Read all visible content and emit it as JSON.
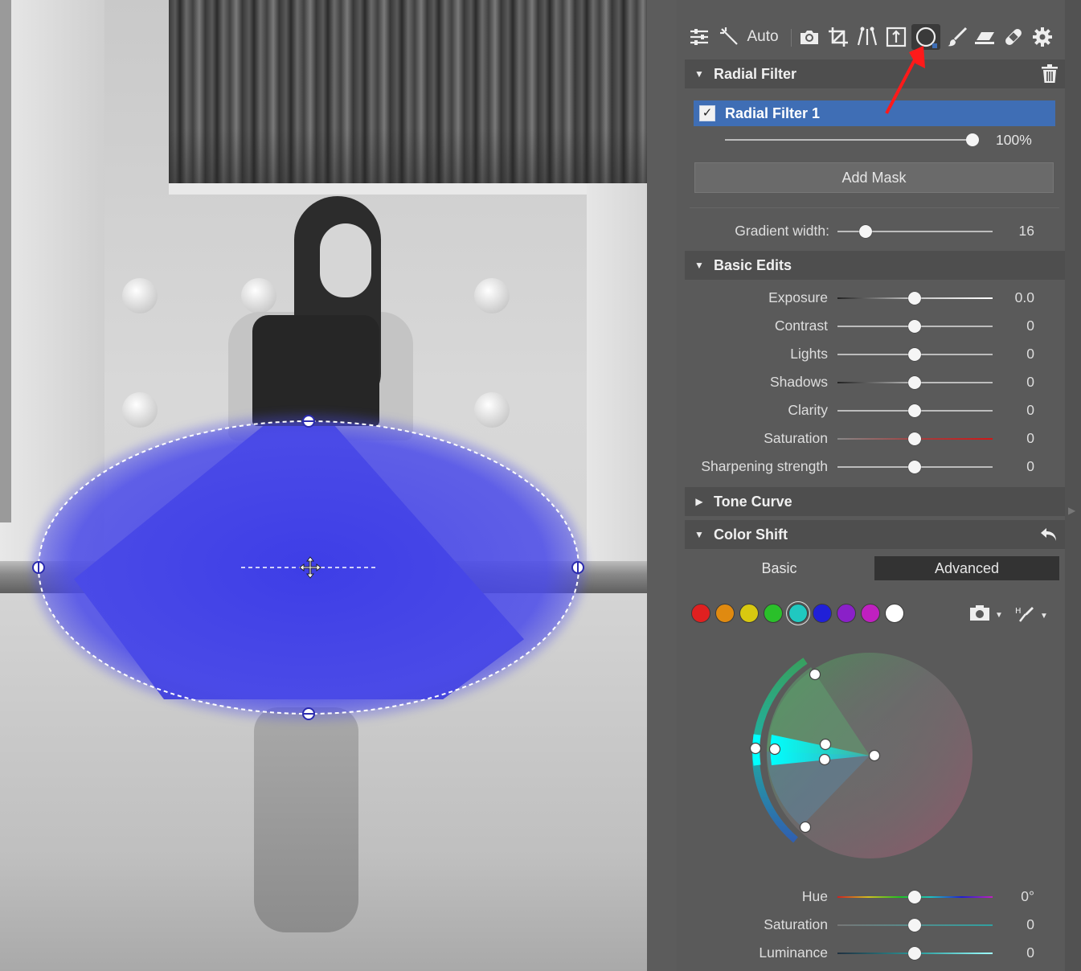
{
  "toolbar": {
    "auto_label": "Auto",
    "active_tool": "radial-filter"
  },
  "radial_filter": {
    "header": "Radial Filter",
    "item_label": "Radial Filter 1",
    "item_checked": true,
    "opacity_value": "100%",
    "opacity_percent": 100,
    "add_mask_label": "Add Mask",
    "gradient_width_label": "Gradient width:",
    "gradient_width_value": "16"
  },
  "basic_edits": {
    "header": "Basic Edits",
    "rows": [
      {
        "label": "Exposure",
        "value": "0.0",
        "track": "exposure"
      },
      {
        "label": "Contrast",
        "value": "0",
        "track": "plain"
      },
      {
        "label": "Lights",
        "value": "0",
        "track": "plain"
      },
      {
        "label": "Shadows",
        "value": "0",
        "track": "shadows"
      },
      {
        "label": "Clarity",
        "value": "0",
        "track": "plain"
      },
      {
        "label": "Saturation",
        "value": "0",
        "track": "saturation"
      },
      {
        "label": "Sharpening strength",
        "value": "0",
        "track": "plain"
      }
    ]
  },
  "tone_curve": {
    "header": "Tone Curve",
    "collapsed": true
  },
  "color_shift": {
    "header": "Color Shift",
    "mode_basic": "Basic",
    "mode_advanced": "Advanced",
    "active_mode": "Advanced",
    "swatches": [
      "#e02020",
      "#e08a10",
      "#d8c810",
      "#2ac02a",
      "#20c8c0",
      "#2020d8",
      "#8a20c8",
      "#c020c0",
      "#ffffff"
    ],
    "selected_swatch": 4,
    "rows": [
      {
        "label": "Hue",
        "value": "0°",
        "track": "hue"
      },
      {
        "label": "Saturation",
        "value": "0",
        "track": "sat2"
      },
      {
        "label": "Luminance",
        "value": "0",
        "track": "lum"
      }
    ]
  },
  "colors": {
    "accent_selected": "#3f6eb5",
    "mask_overlay": "#4b4bea",
    "annotation_arrow": "#ff1a1a"
  }
}
